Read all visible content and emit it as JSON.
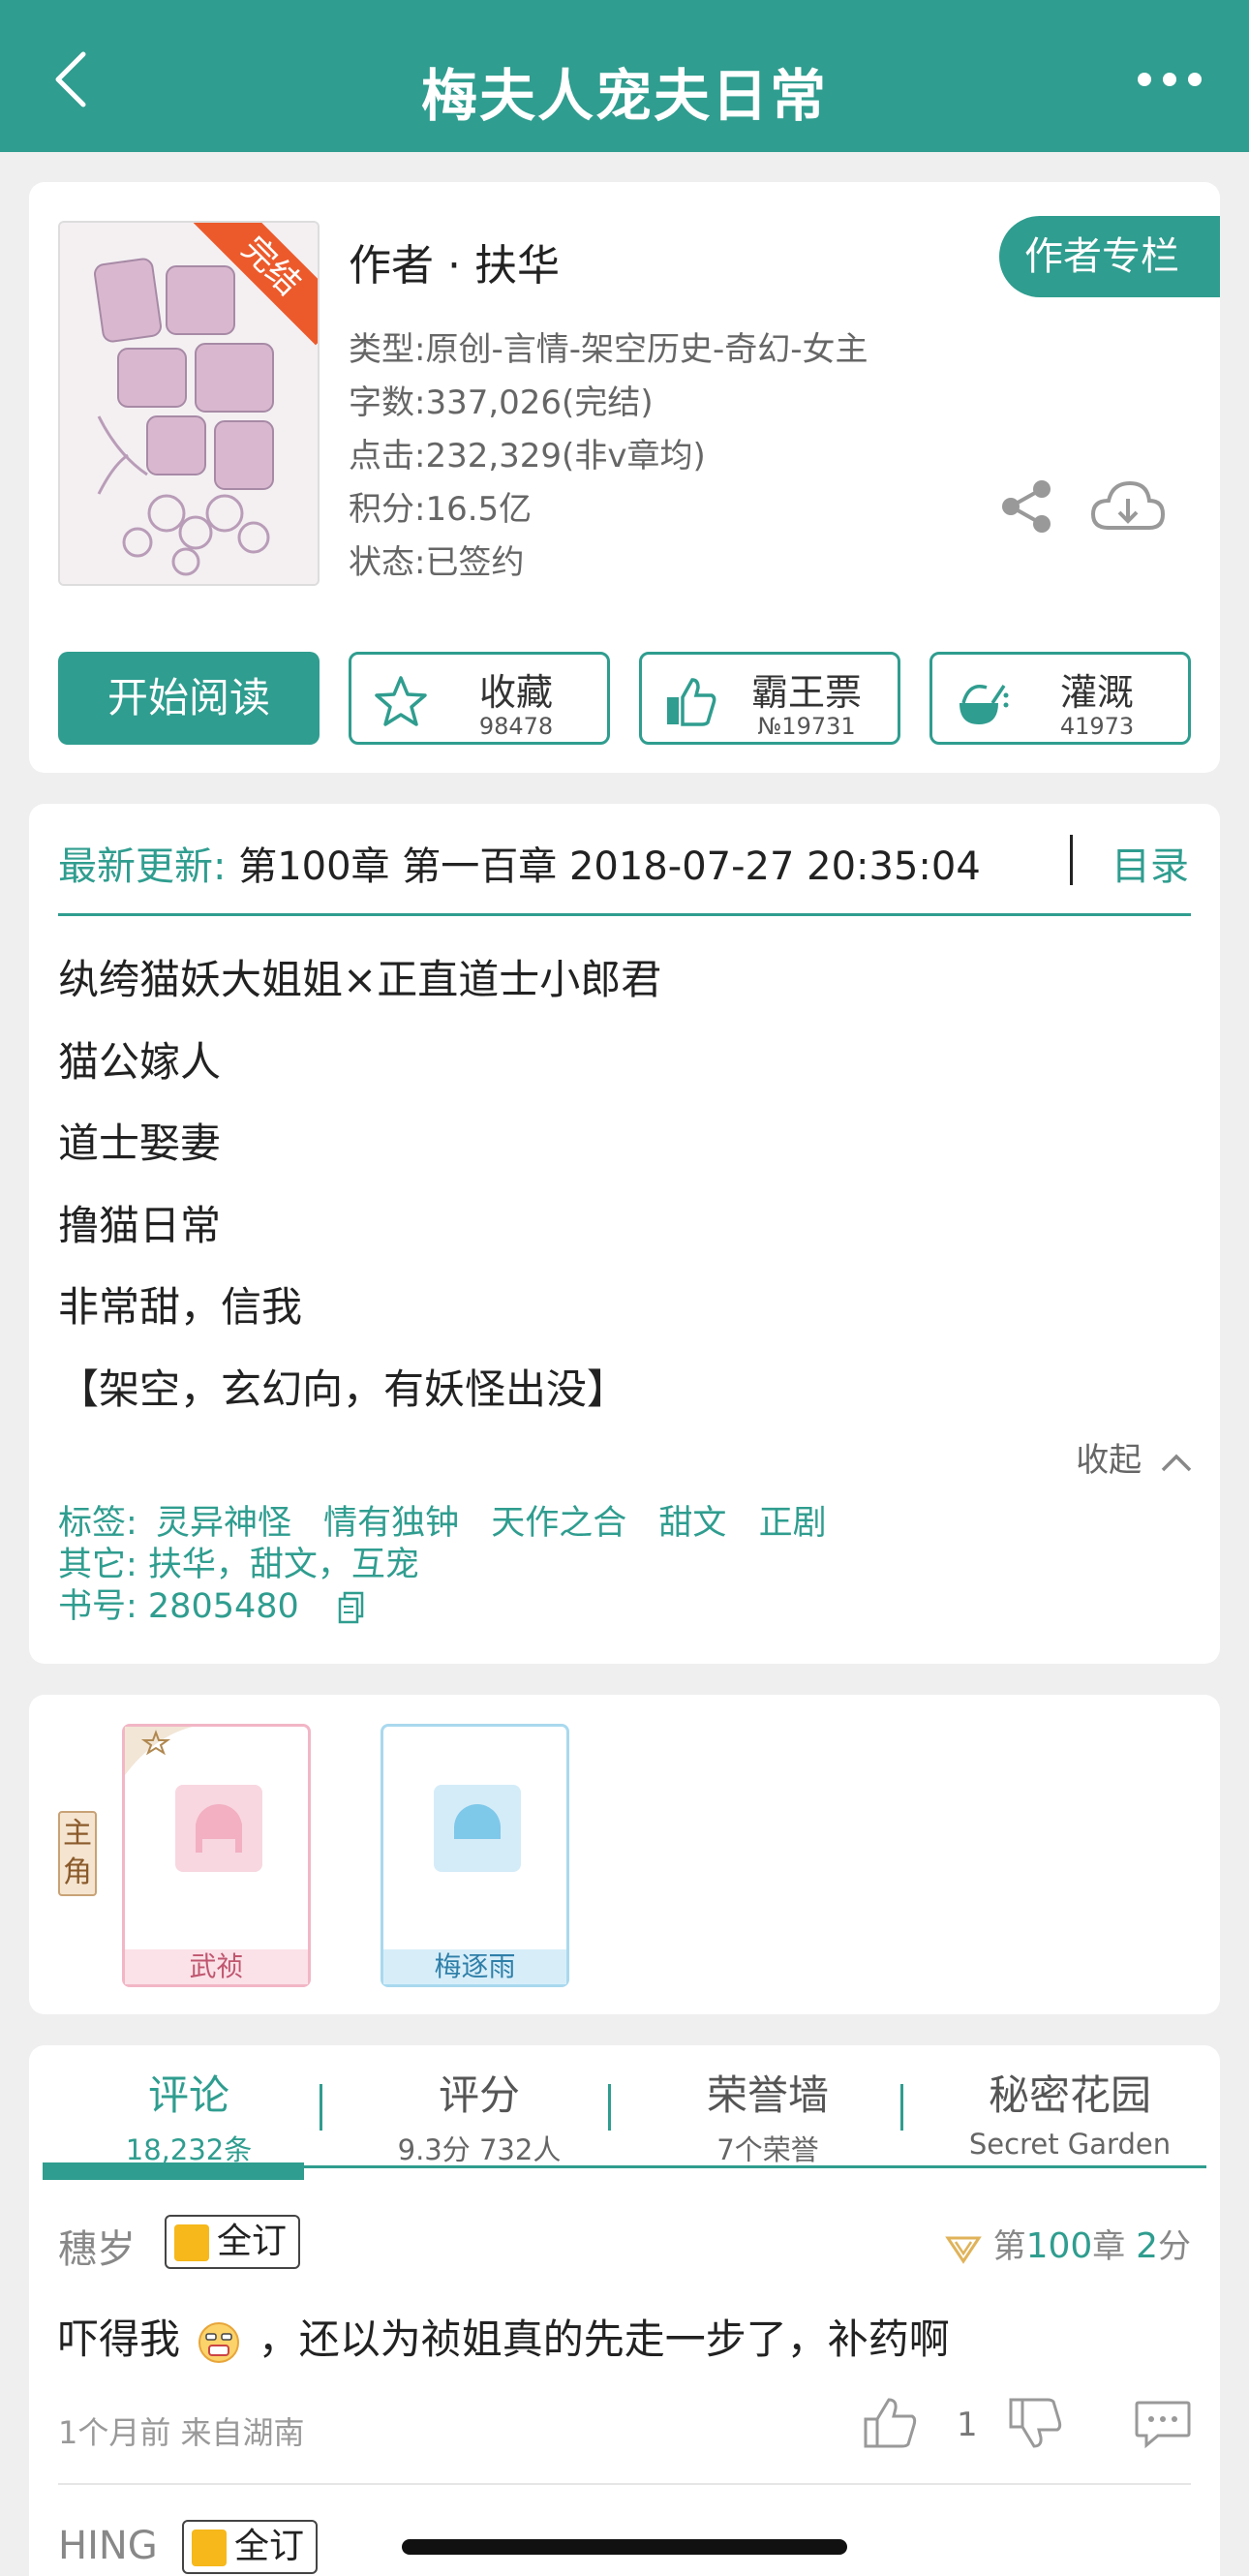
{
  "header": {
    "title": "梅夫人宠夫日常"
  },
  "book": {
    "status_ribbon": "完结",
    "author": "作者 · 扶华",
    "author_column": "作者专栏",
    "genre": "类型:原创-言情-架空历史-奇幻-女主",
    "words": "字数:337,026(完结)",
    "clicks": "点击:232,329(非v章均)",
    "score": "积分:16.5亿",
    "state": "状态:已签约"
  },
  "actions": {
    "read": "开始阅读",
    "favorite": {
      "label": "收藏",
      "count": "98478"
    },
    "vote": {
      "label": "霸王票",
      "count": "№19731"
    },
    "water": {
      "label": "灌溉",
      "count": "41973"
    }
  },
  "update": {
    "label": "最新更新:",
    "text": "第100章 第一百章 2018-07-27 20:35:04",
    "catalog": "目录"
  },
  "synopsis": [
    "纨绔猫妖大姐姐×正直道士小郎君",
    "猫公嫁人",
    "道士娶妻",
    "撸猫日常",
    "非常甜，信我",
    "【架空，玄幻向，有妖怪出没】"
  ],
  "collapse": "收起",
  "tags": {
    "label": "标签:",
    "items": [
      "灵异神怪",
      "情有独钟",
      "天作之合",
      "甜文",
      "正剧"
    ],
    "other": "其它:  扶华，甜文，互宠",
    "id": "书号:  2805480"
  },
  "characters": {
    "role": [
      "主",
      "角"
    ],
    "list": [
      {
        "name": "武祯"
      },
      {
        "name": "梅逐雨"
      }
    ]
  },
  "tabs": [
    {
      "title": "评论",
      "sub": "18,232条"
    },
    {
      "title": "评分",
      "sub": "9.3分 732人"
    },
    {
      "title": "荣誉墙",
      "sub": "7个荣誉"
    },
    {
      "title": "秘密花园",
      "sub": "Secret Garden"
    }
  ],
  "comments": [
    {
      "user": "穗岁",
      "badge": "全订",
      "chapter_prefix": "第",
      "chapter_num": "100",
      "chapter_mid": "章",
      "score_num": "2",
      "score_unit": "分",
      "text": "吓得我",
      "text2": "，还以为祯姐真的先走一步了，补药啊",
      "time": "1个月前  来自湖南",
      "likes": "1"
    },
    {
      "user": "HING",
      "badge": "全订"
    }
  ],
  "colors": {
    "accent": "#2f9d8f",
    "ribbon": "#ec5a2c",
    "badge": "#f6b81b"
  }
}
